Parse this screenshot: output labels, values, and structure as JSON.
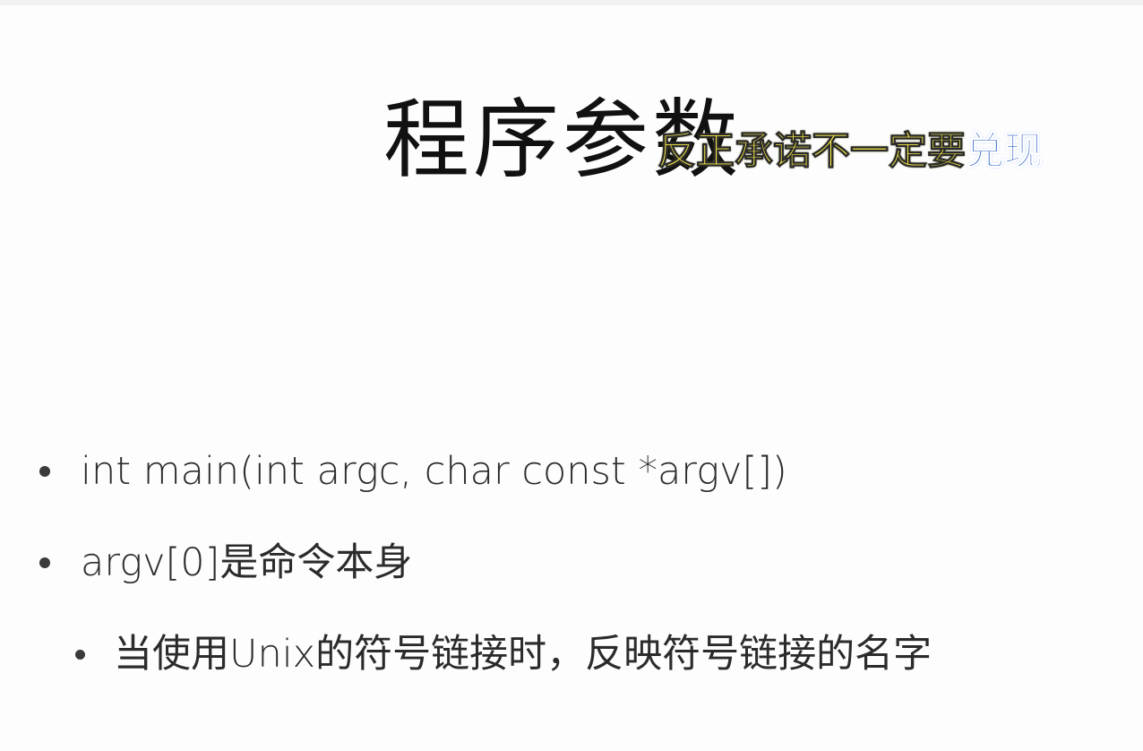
{
  "slide": {
    "title": "程序参数",
    "overlay_caption": {
      "yellow_part": "反正承诺不一定要",
      "blue_part": "兑现"
    },
    "bullets": [
      {
        "text": "int main(int argc, char const *argv[])",
        "level": 1
      },
      {
        "text": "argv[0]是命令本身",
        "level": 1
      },
      {
        "text": "当使用Unix的符号链接时，反映符号链接的名字",
        "level": 2
      }
    ]
  }
}
